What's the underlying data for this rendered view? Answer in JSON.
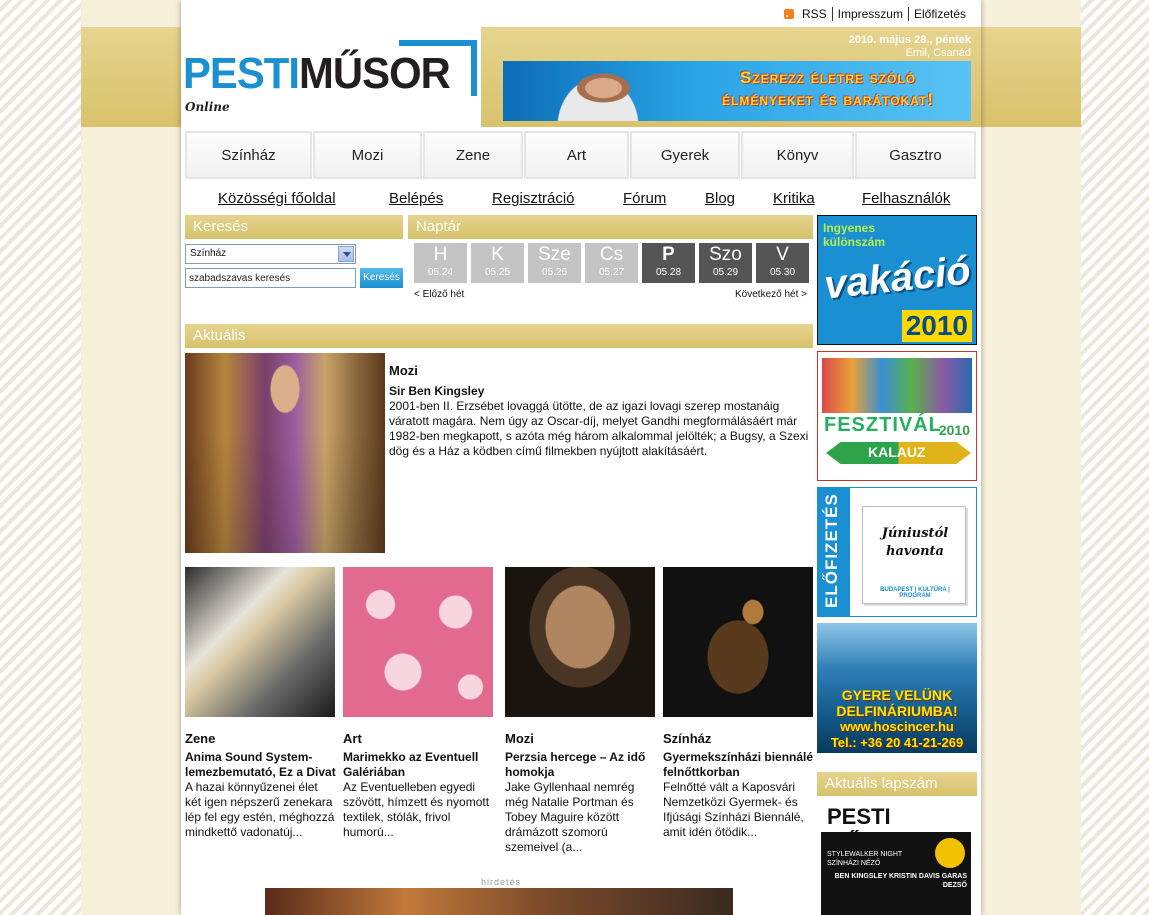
{
  "header": {
    "toplinks": [
      "RSS",
      "Impresszum",
      "Előfizetés"
    ],
    "logo": {
      "part1": "PESTI",
      "part2": "MŰSOR",
      "online": "Online"
    },
    "date": "2010. május 28., péntek",
    "nameday": "Emil, Csanád",
    "banner_text": "Szerezz életre szóló élményeket és barátokat!"
  },
  "mainnav": [
    "Színház",
    "Mozi",
    "Zene",
    "Art",
    "Gyerek",
    "Könyv",
    "Gasztro"
  ],
  "subnav": [
    "Közösségi főoldal",
    "Belépés",
    "Regisztráció",
    "Fórum",
    "Blog",
    "Kritika",
    "Felhasználók"
  ],
  "search": {
    "title": "Keresés",
    "selected": "Színház",
    "placeholder": "szabadszavas keresés",
    "button": "Keresés"
  },
  "calendar": {
    "title": "Naptár",
    "days": [
      {
        "name": "H",
        "date": "05.24",
        "active": false
      },
      {
        "name": "K",
        "date": "05.25",
        "active": false
      },
      {
        "name": "Sze",
        "date": "05.26",
        "active": false
      },
      {
        "name": "Cs",
        "date": "05.27",
        "active": false
      },
      {
        "name": "P",
        "date": "05.28",
        "active": true
      },
      {
        "name": "Szo",
        "date": "05.29",
        "active": true
      },
      {
        "name": "V",
        "date": "05.30",
        "active": true
      }
    ],
    "prev": "< Előző hét",
    "next": "Következő hét >"
  },
  "aktualis": {
    "title": "Aktuális",
    "featured": {
      "category": "Mozi",
      "title": "Sir Ben Kingsley",
      "text": "2001-ben II. Erzsébet lovaggá ütötte, de az igazi lovagi szerep mostanáig váratott magára. Nem úgy az Oscar-díj, melyet Gandhi megformálásáért már 1982-ben megkapott, s azóta még három alkalommal jelölték; a Bugsy, a Szexi dög és a Ház a ködben című filmekben nyújtott alakításáért."
    },
    "cards": [
      {
        "category": "Zene",
        "title": "Anima Sound System-lemezbemutató, Ez a Divat",
        "text": "A hazai könnyűzenei élet két igen népszerű zenekara lép fel egy estén, méghozzá mindkettő vadonatúj..."
      },
      {
        "category": "Art",
        "title": "Marimekko az Eventuell Galériában",
        "text": "Az Eventuelleben egyedi szövött, hímzett és nyomott textilek, stólák, frivol humorú..."
      },
      {
        "category": "Mozi",
        "title": "Perzsia hercege – Az idő homokja",
        "text": "Jake Gyllenhaal nemrég még Natalie Portman és Tobey Maguire között drámázott szomorú szemeivel (a..."
      },
      {
        "category": "Színház",
        "title": "Gyermekszínházi biennálé felnőttkorban",
        "text": "Felnőtté vált a Kaposvári Nemzetközi Gyermek- és Ifjúsági Színházi Biennálé, amit idén ötödik..."
      }
    ]
  },
  "ad_label": "hirdetés",
  "right_ads": {
    "vakacio": {
      "line1": "Ingyenes",
      "line2": "különszám",
      "title": "vakáció",
      "year": "2010"
    },
    "fesztival": {
      "fest": "FESZTIVÁL",
      "kalauz": "KALAUZ",
      "year": "2010"
    },
    "elofizetes": {
      "vertical": "ELŐFIZETÉS",
      "note": "Júniustól havonta",
      "footer": "BUDAPEST | KULTÚRA | PROGRAM"
    },
    "delfin": {
      "l1": "GYERE VELÜNK",
      "l2": "DELFINÁRIUMBA!",
      "l3": "www.hoscincer.hu",
      "l4": "Tel.: +36 20 41-21-269"
    }
  },
  "lapszam": {
    "title": "Aktuális lapszám",
    "mast": "PESTI MŰSOR",
    "small": "STYLEWALKER NIGHT",
    "small2": "SZÍNHÁZI NÉZŐ",
    "right": "BEN KINGSLEY KRISTIN DAVIS GARAS DEZSŐ"
  },
  "colors": {
    "accent_blue": "#1a8fd2",
    "gold": "#e0cd80",
    "active_day": "#555555",
    "inactive_day": "#c4c4c4"
  }
}
